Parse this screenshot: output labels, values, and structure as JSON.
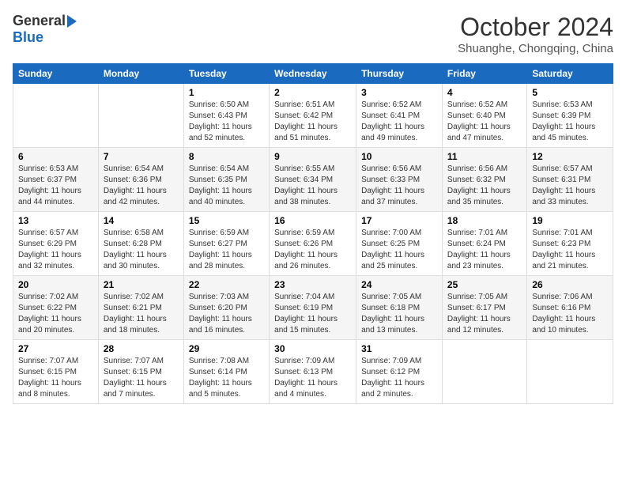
{
  "logo": {
    "general": "General",
    "blue": "Blue"
  },
  "header": {
    "month": "October 2024",
    "location": "Shuanghe, Chongqing, China"
  },
  "weekdays": [
    "Sunday",
    "Monday",
    "Tuesday",
    "Wednesday",
    "Thursday",
    "Friday",
    "Saturday"
  ],
  "weeks": [
    [
      {
        "day": "",
        "info": ""
      },
      {
        "day": "",
        "info": ""
      },
      {
        "day": "1",
        "info": "Sunrise: 6:50 AM\nSunset: 6:43 PM\nDaylight: 11 hours and 52 minutes."
      },
      {
        "day": "2",
        "info": "Sunrise: 6:51 AM\nSunset: 6:42 PM\nDaylight: 11 hours and 51 minutes."
      },
      {
        "day": "3",
        "info": "Sunrise: 6:52 AM\nSunset: 6:41 PM\nDaylight: 11 hours and 49 minutes."
      },
      {
        "day": "4",
        "info": "Sunrise: 6:52 AM\nSunset: 6:40 PM\nDaylight: 11 hours and 47 minutes."
      },
      {
        "day": "5",
        "info": "Sunrise: 6:53 AM\nSunset: 6:39 PM\nDaylight: 11 hours and 45 minutes."
      }
    ],
    [
      {
        "day": "6",
        "info": "Sunrise: 6:53 AM\nSunset: 6:37 PM\nDaylight: 11 hours and 44 minutes."
      },
      {
        "day": "7",
        "info": "Sunrise: 6:54 AM\nSunset: 6:36 PM\nDaylight: 11 hours and 42 minutes."
      },
      {
        "day": "8",
        "info": "Sunrise: 6:54 AM\nSunset: 6:35 PM\nDaylight: 11 hours and 40 minutes."
      },
      {
        "day": "9",
        "info": "Sunrise: 6:55 AM\nSunset: 6:34 PM\nDaylight: 11 hours and 38 minutes."
      },
      {
        "day": "10",
        "info": "Sunrise: 6:56 AM\nSunset: 6:33 PM\nDaylight: 11 hours and 37 minutes."
      },
      {
        "day": "11",
        "info": "Sunrise: 6:56 AM\nSunset: 6:32 PM\nDaylight: 11 hours and 35 minutes."
      },
      {
        "day": "12",
        "info": "Sunrise: 6:57 AM\nSunset: 6:31 PM\nDaylight: 11 hours and 33 minutes."
      }
    ],
    [
      {
        "day": "13",
        "info": "Sunrise: 6:57 AM\nSunset: 6:29 PM\nDaylight: 11 hours and 32 minutes."
      },
      {
        "day": "14",
        "info": "Sunrise: 6:58 AM\nSunset: 6:28 PM\nDaylight: 11 hours and 30 minutes."
      },
      {
        "day": "15",
        "info": "Sunrise: 6:59 AM\nSunset: 6:27 PM\nDaylight: 11 hours and 28 minutes."
      },
      {
        "day": "16",
        "info": "Sunrise: 6:59 AM\nSunset: 6:26 PM\nDaylight: 11 hours and 26 minutes."
      },
      {
        "day": "17",
        "info": "Sunrise: 7:00 AM\nSunset: 6:25 PM\nDaylight: 11 hours and 25 minutes."
      },
      {
        "day": "18",
        "info": "Sunrise: 7:01 AM\nSunset: 6:24 PM\nDaylight: 11 hours and 23 minutes."
      },
      {
        "day": "19",
        "info": "Sunrise: 7:01 AM\nSunset: 6:23 PM\nDaylight: 11 hours and 21 minutes."
      }
    ],
    [
      {
        "day": "20",
        "info": "Sunrise: 7:02 AM\nSunset: 6:22 PM\nDaylight: 11 hours and 20 minutes."
      },
      {
        "day": "21",
        "info": "Sunrise: 7:02 AM\nSunset: 6:21 PM\nDaylight: 11 hours and 18 minutes."
      },
      {
        "day": "22",
        "info": "Sunrise: 7:03 AM\nSunset: 6:20 PM\nDaylight: 11 hours and 16 minutes."
      },
      {
        "day": "23",
        "info": "Sunrise: 7:04 AM\nSunset: 6:19 PM\nDaylight: 11 hours and 15 minutes."
      },
      {
        "day": "24",
        "info": "Sunrise: 7:05 AM\nSunset: 6:18 PM\nDaylight: 11 hours and 13 minutes."
      },
      {
        "day": "25",
        "info": "Sunrise: 7:05 AM\nSunset: 6:17 PM\nDaylight: 11 hours and 12 minutes."
      },
      {
        "day": "26",
        "info": "Sunrise: 7:06 AM\nSunset: 6:16 PM\nDaylight: 11 hours and 10 minutes."
      }
    ],
    [
      {
        "day": "27",
        "info": "Sunrise: 7:07 AM\nSunset: 6:15 PM\nDaylight: 11 hours and 8 minutes."
      },
      {
        "day": "28",
        "info": "Sunrise: 7:07 AM\nSunset: 6:15 PM\nDaylight: 11 hours and 7 minutes."
      },
      {
        "day": "29",
        "info": "Sunrise: 7:08 AM\nSunset: 6:14 PM\nDaylight: 11 hours and 5 minutes."
      },
      {
        "day": "30",
        "info": "Sunrise: 7:09 AM\nSunset: 6:13 PM\nDaylight: 11 hours and 4 minutes."
      },
      {
        "day": "31",
        "info": "Sunrise: 7:09 AM\nSunset: 6:12 PM\nDaylight: 11 hours and 2 minutes."
      },
      {
        "day": "",
        "info": ""
      },
      {
        "day": "",
        "info": ""
      }
    ]
  ]
}
